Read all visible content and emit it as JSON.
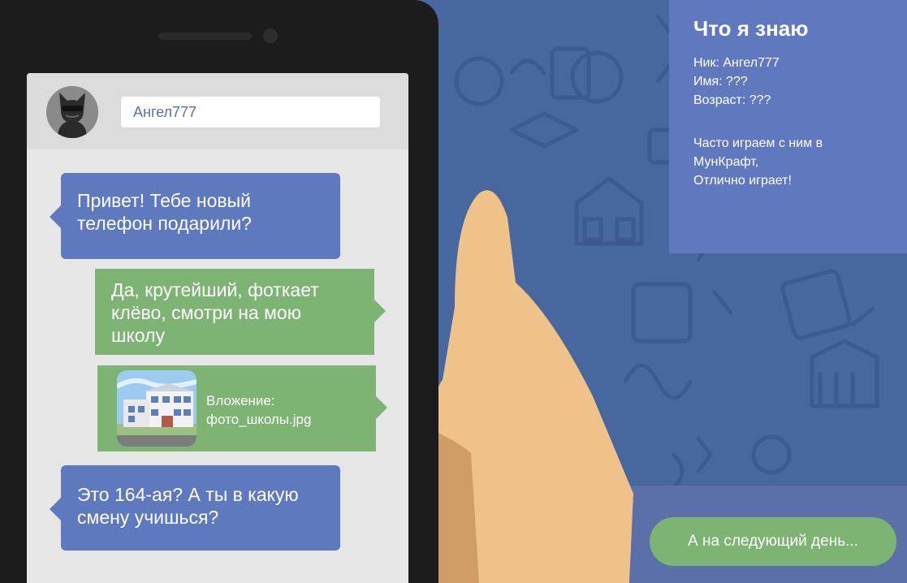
{
  "contact": {
    "name": "Ангел777",
    "avatar_icon": "masked-cat-avatar-icon"
  },
  "messages": [
    {
      "from": "contact",
      "text": "Привет! Тебе новый телефон подарили?"
    },
    {
      "from": "me",
      "text": "Да, крутейший, фоткает клёво, смотри на мою школу"
    },
    {
      "from": "me",
      "type": "attachment",
      "label": "Вложение:",
      "filename": "фото_школы.jpg",
      "icon": "school-photo-thumbnail"
    },
    {
      "from": "contact",
      "text": "Это 164-ая? А ты в какую смену учишься?"
    }
  ],
  "info_panel": {
    "title": "Что я знаю",
    "nick": "Ник: Ангел777",
    "name": "Имя: ???",
    "age": "Возраст: ???",
    "note_line1": "Часто играем с ним в",
    "note_line2": "МунКрафт,",
    "note_line3": "Отлично играет!"
  },
  "next_button": {
    "label": "А на следующий день..."
  },
  "colors": {
    "incoming_bubble": "#5e79bd",
    "outgoing_bubble": "#7db474",
    "background": "#48679f",
    "info_panel": "#6079be"
  }
}
